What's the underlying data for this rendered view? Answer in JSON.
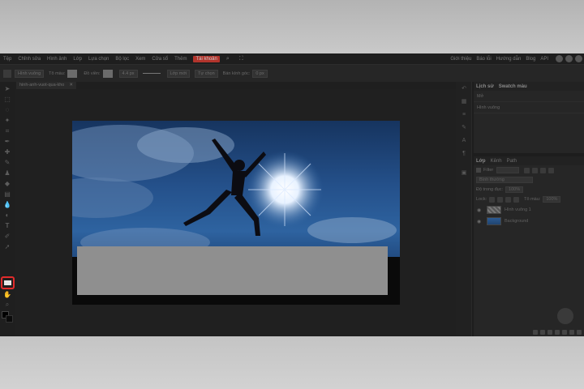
{
  "menu": {
    "items": [
      "Tệp",
      "Chỉnh sửa",
      "Hình ảnh",
      "Lớp",
      "Lựa chọn",
      "Bộ lọc",
      "Xem",
      "Cửa sổ",
      "Thêm",
      "Tài khoản"
    ],
    "active": "Tài khoản",
    "right_items": [
      "Giới thiệu",
      "Báo lỗi",
      "Hướng dẫn",
      "Blog",
      "API"
    ]
  },
  "options": {
    "shape_type": "Hình vuông",
    "fill_label": "Tô màu:",
    "stroke_label": "Đồ viền:",
    "stroke_width": "4.4 px",
    "align_label": "Lớp mới",
    "more_label": "Tự chọn",
    "radius_label": "Bán kính góc:",
    "radius_value": "0 px"
  },
  "document": {
    "tab_title": "hinh-anh-vuot-qua-kho",
    "close": "✕"
  },
  "colors": {
    "accent": "#e12b2b",
    "canvas_rect": "#8f8f8f",
    "sky": "#2e63a0"
  },
  "history": {
    "tabs": [
      "Lịch sử",
      "Swatch màu"
    ],
    "entries": [
      "Mở",
      "Hình vuông"
    ]
  },
  "layers": {
    "tabs": [
      "Lớp",
      "Kênh",
      "Path"
    ],
    "filter_label": "Filter",
    "blend_mode": "Bình thường",
    "opacity_label": "Độ trong đục:",
    "opacity_value": "100%",
    "lock_label": "Lock:",
    "fill_label": "Tô màu:",
    "fill_value": "100%",
    "items": [
      {
        "name": "Hình vuông 1"
      },
      {
        "name": "Background"
      }
    ]
  },
  "icons": {
    "tools": [
      "move-icon",
      "marquee-icon",
      "lasso-icon",
      "magic-wand-icon",
      "crop-icon",
      "eyedropper-icon",
      "healing-icon",
      "brush-icon",
      "stamp-icon",
      "eraser-icon",
      "gradient-icon",
      "blur-icon",
      "dodge-icon",
      "text-icon",
      "pen-icon",
      "path-select-icon",
      "rectangle-icon",
      "hand-icon",
      "zoom-icon"
    ],
    "highlighted_tool": "rectangle-icon"
  }
}
